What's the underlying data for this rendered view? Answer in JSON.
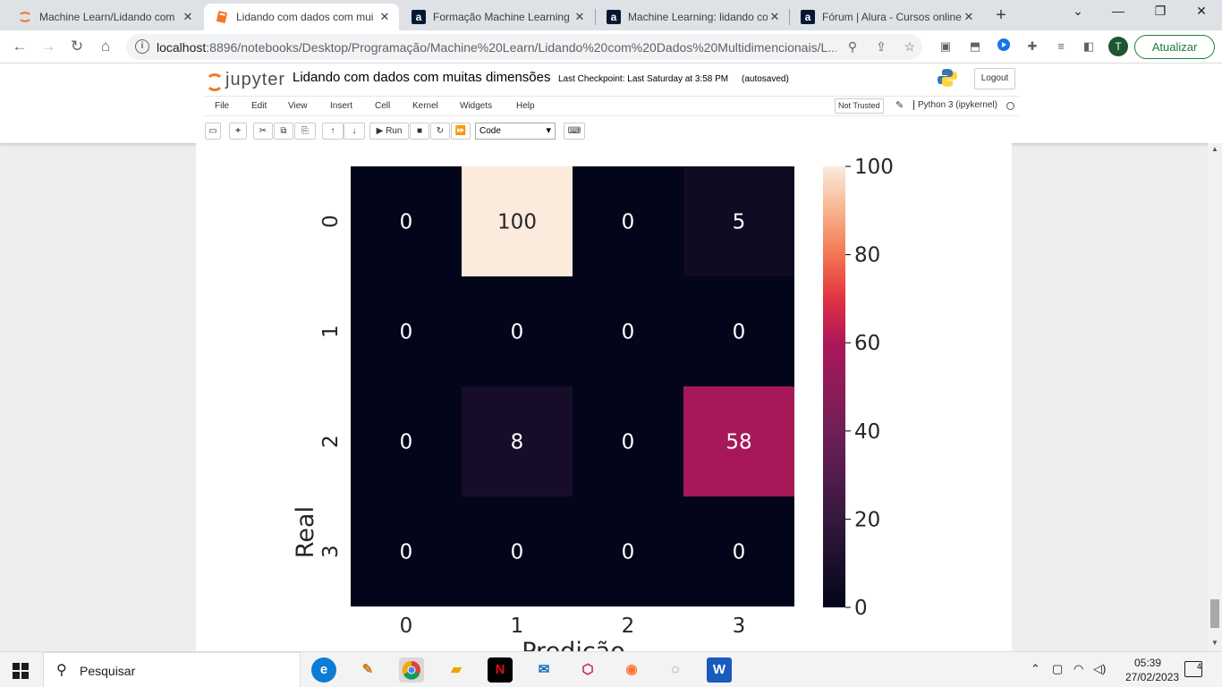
{
  "browser": {
    "tabs": [
      {
        "title": "Machine Learn/Lidando com",
        "favicon": "jupyter-icon"
      },
      {
        "title": "Lidando com dados com mui",
        "favicon": "notebook-icon"
      },
      {
        "title": "Formação Machine Learning",
        "favicon": "alura-icon"
      },
      {
        "title": "Machine Learning: lidando co",
        "favicon": "alura-icon"
      },
      {
        "title": "Fórum | Alura - Cursos online",
        "favicon": "alura-icon"
      }
    ],
    "new_tab": "+",
    "url_host": "localhost",
    "url_rest": ":8896/notebooks/Desktop/Programação/Machine%20Learn/Lidando%20com%20Dados%20Multidimencionais/L...",
    "profile_initial": "T",
    "update_label": "Atualizar"
  },
  "jupyter": {
    "logo_text": "jupyter",
    "notebook_name": "Lidando com dados com muitas dimensões",
    "checkpoint": "Last Checkpoint: Last Saturday at 3:58 PM",
    "autosave": "(autosaved)",
    "logout_label": "Logout",
    "menu": [
      "File",
      "Edit",
      "View",
      "Insert",
      "Cell",
      "Kernel",
      "Widgets",
      "Help"
    ],
    "trust_label": "Not Trusted",
    "kernel_name": "Python 3 (ipykernel)",
    "run_label": "Run",
    "cell_type": "Code"
  },
  "chart_data": {
    "type": "heatmap",
    "title": "",
    "xlabel": "Predição",
    "ylabel": "Real",
    "x_categories": [
      "0",
      "1",
      "2",
      "3"
    ],
    "y_categories": [
      "0",
      "1",
      "2",
      "3"
    ],
    "values": [
      [
        0,
        100,
        0,
        5
      ],
      [
        0,
        0,
        0,
        0
      ],
      [
        0,
        8,
        0,
        58
      ],
      [
        0,
        0,
        0,
        0
      ]
    ],
    "colorbar_ticks": [
      "0",
      "20",
      "40",
      "60",
      "80",
      "100"
    ],
    "colorbar_range": [
      0,
      100
    ],
    "colormap": "rocket"
  },
  "taskbar": {
    "search_placeholder": "Pesquisar",
    "time": "05:39",
    "date": "27/02/2023",
    "notifications": "4"
  }
}
